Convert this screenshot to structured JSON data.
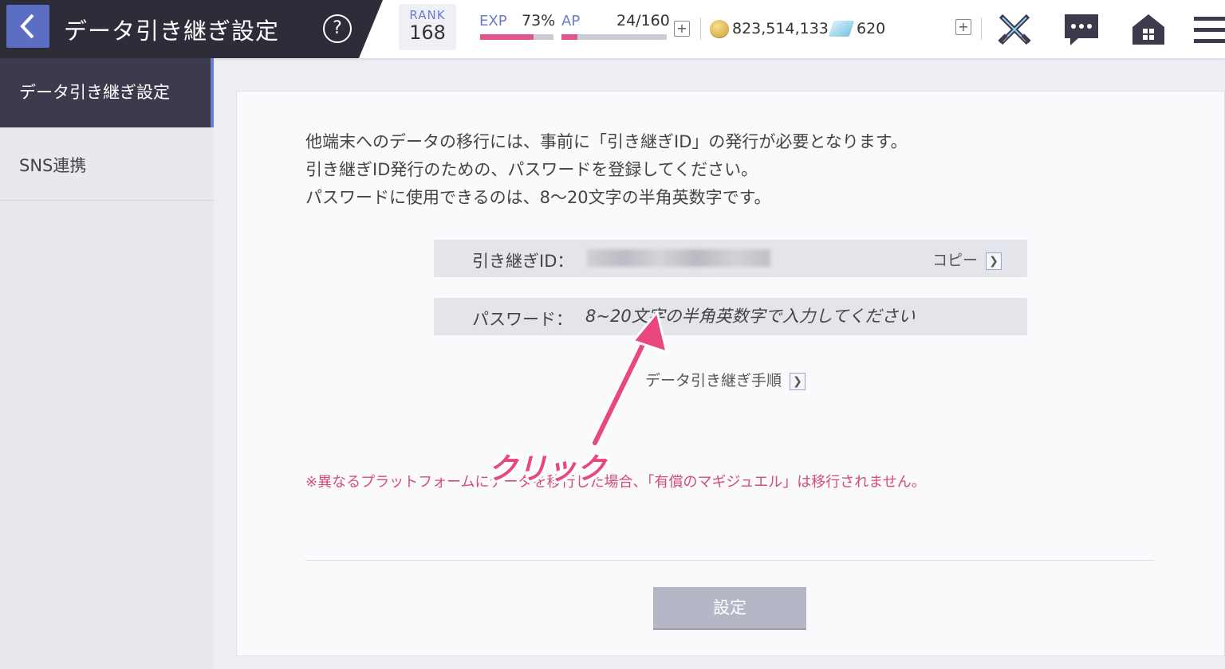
{
  "header": {
    "title": "データ引き継ぎ設定",
    "help_symbol": "?",
    "rank_label": "RANK",
    "rank_value": "168",
    "exp_label": "EXP",
    "exp_value": "73%",
    "exp_fraction": 0.73,
    "ap_label": "AP",
    "ap_value": "24/160",
    "ap_fraction": 0.15,
    "plus": "+",
    "coins": "823,514,133",
    "gems": "620",
    "icons": [
      "back-icon",
      "help-icon",
      "coin-icon",
      "gem-icon",
      "swords-icon",
      "chat-icon",
      "home-icon",
      "menu-icon"
    ]
  },
  "sidebar": {
    "items": [
      {
        "label": "データ引き継ぎ設定"
      },
      {
        "label": "SNS連携"
      }
    ]
  },
  "main": {
    "intro_lines": [
      "他端末へのデータの移行には、事前に「引き継ぎID」の発行が必要となります。",
      "引き継ぎID発行のための、パスワードを登録してください。",
      "パスワードに使用できるのは、8〜20文字の半角英数字です。"
    ],
    "id_label": "引き継ぎID：",
    "copy_label": "コピー",
    "password_label": "パスワード：",
    "password_placeholder": "8~20文字の半角英数字で入力してください",
    "password_value": "",
    "procedure_label": "データ引き継ぎ手順",
    "warning": "※異なるプラットフォームにデータを移行した場合、「有償のマギジュエル」は移行されません。",
    "submit_label": "設定"
  },
  "annotation": {
    "text": "クリック",
    "color": "#e8487e"
  },
  "colors": {
    "accent": "#6b7bd0",
    "title_bg": "#2d2d3a",
    "bar_fill": "#e2548e",
    "warning": "#d34d76",
    "button_disabled": "#b5b7c7"
  }
}
